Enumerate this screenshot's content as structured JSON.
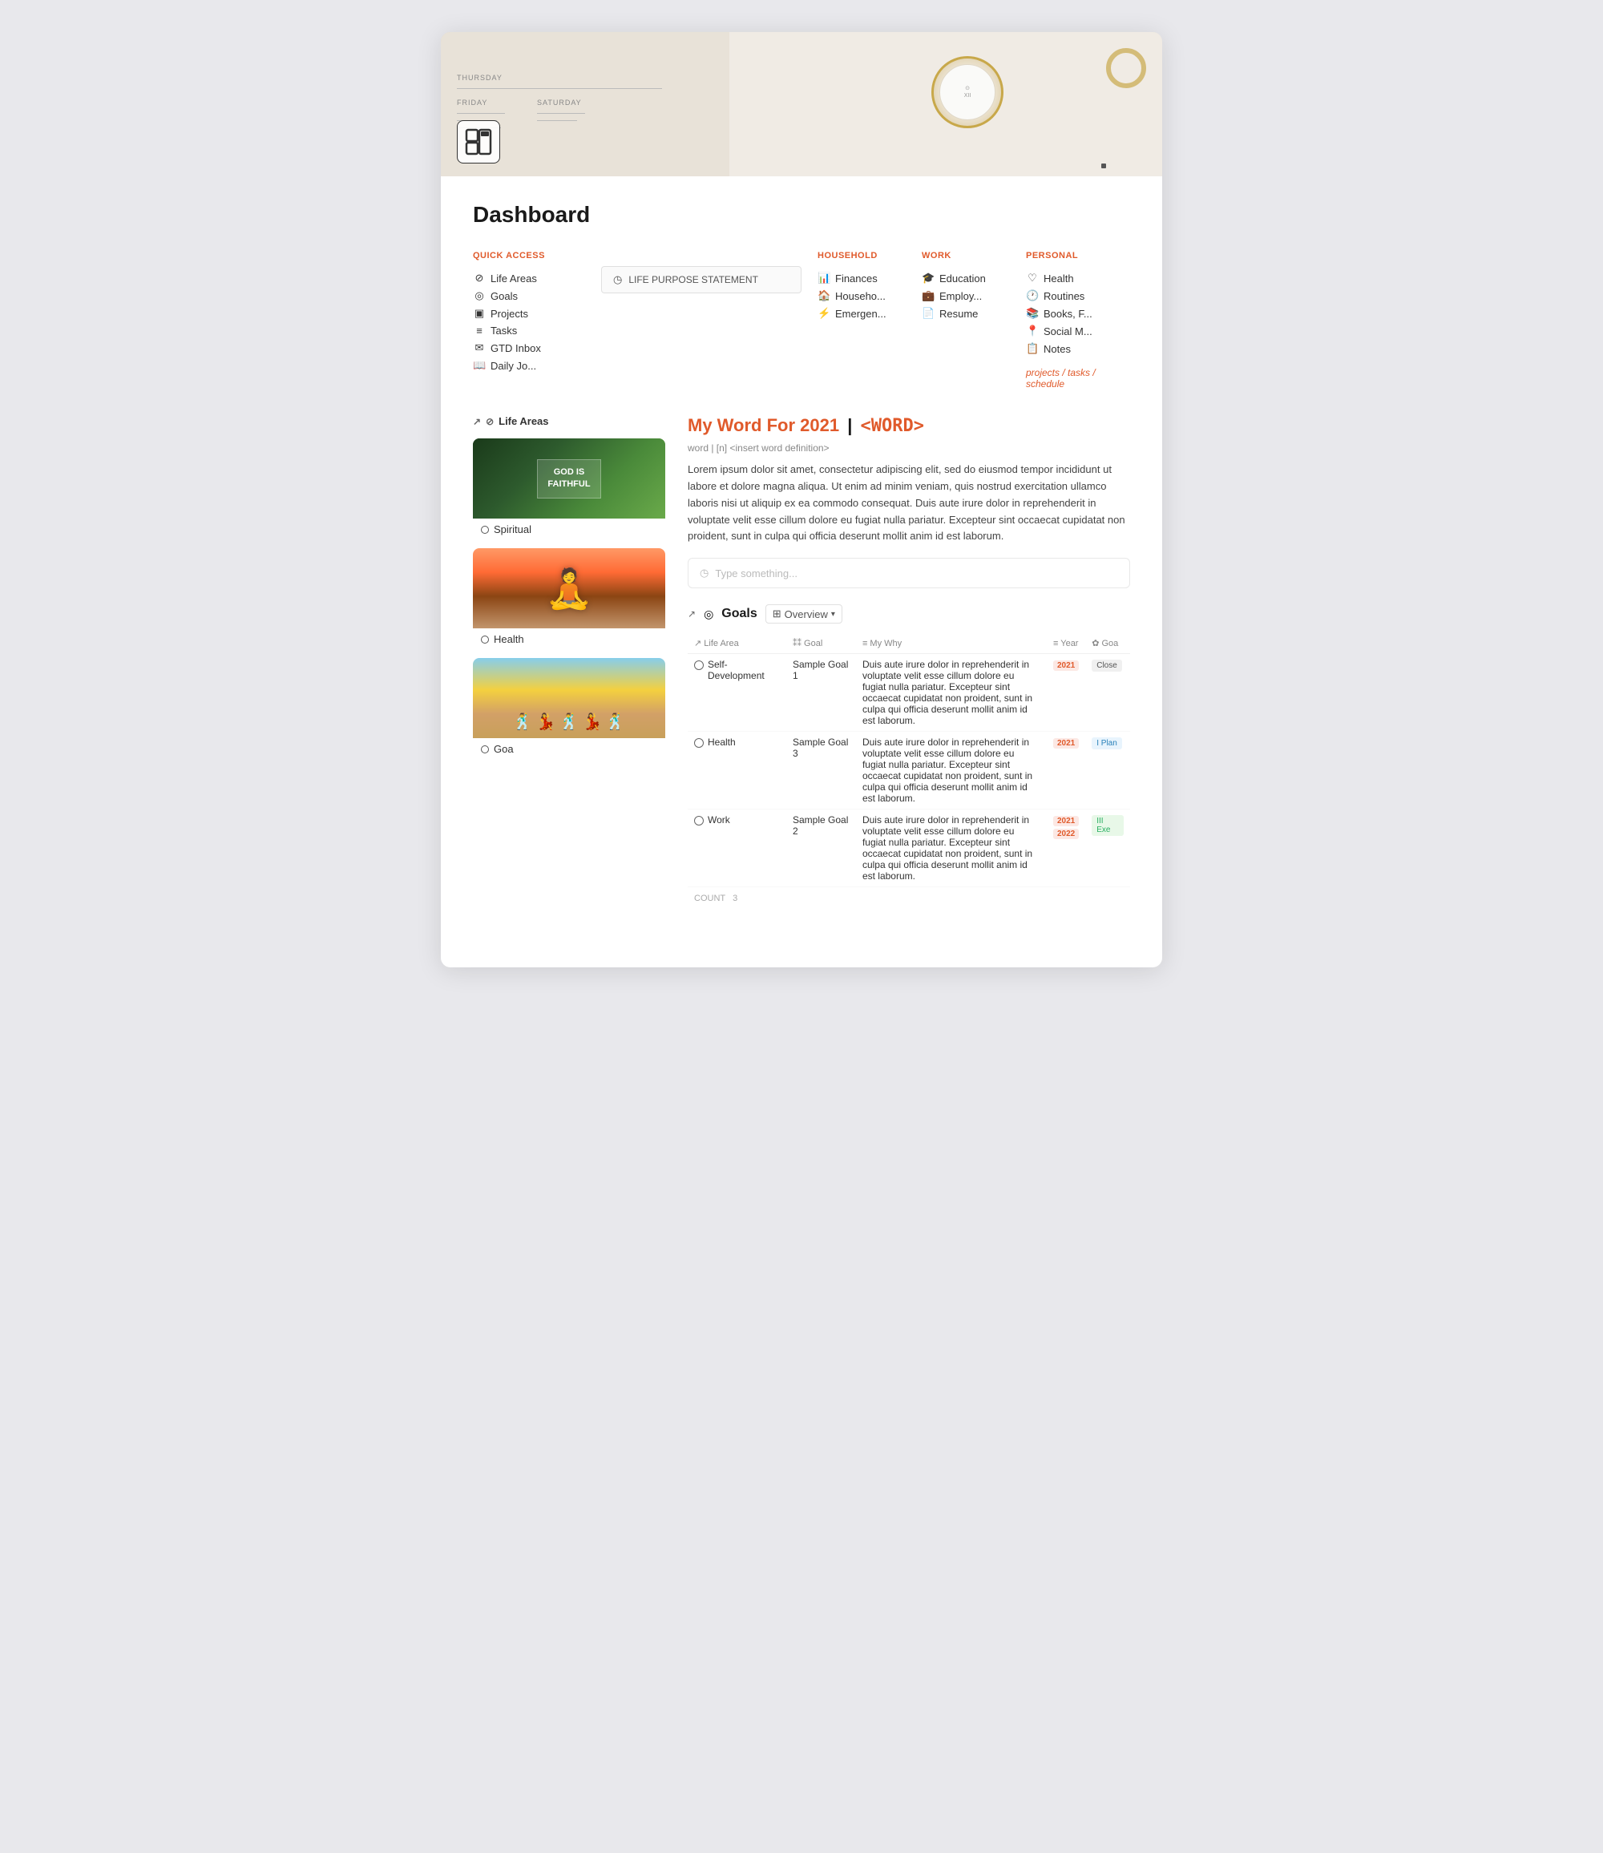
{
  "page": {
    "title": "Dashboard"
  },
  "hero": {
    "alt": "Planner and watch hero image"
  },
  "nav": {
    "quick_access": {
      "title": "QUICK ACCESS",
      "items": [
        {
          "label": "Life Areas",
          "icon": "⊘"
        },
        {
          "label": "Goals",
          "icon": "◎"
        },
        {
          "label": "Projects",
          "icon": "▣"
        },
        {
          "label": "Tasks",
          "icon": "≡"
        },
        {
          "label": "GTD Inbox",
          "icon": "✉"
        },
        {
          "label": "Daily Jo...",
          "icon": "📖"
        }
      ]
    },
    "life_purpose": {
      "label": "LIFE PURPOSE STATEMENT"
    },
    "household": {
      "title": "HOUSEHOLD",
      "items": [
        {
          "label": "Finances",
          "icon": "📊"
        },
        {
          "label": "Househo...",
          "icon": "🏠"
        },
        {
          "label": "Emergen...",
          "icon": "⚡"
        }
      ]
    },
    "work": {
      "title": "WORK",
      "items": [
        {
          "label": "Education",
          "icon": "🎓"
        },
        {
          "label": "Employ...",
          "icon": "💼"
        },
        {
          "label": "Resume",
          "icon": "📄"
        }
      ]
    },
    "personal": {
      "title": "PERSONAL",
      "items": [
        {
          "label": "Health",
          "icon": "♡"
        },
        {
          "label": "Routines",
          "icon": "🕐"
        },
        {
          "label": "Books, F...",
          "icon": "📚"
        },
        {
          "label": "Social M...",
          "icon": "📍"
        },
        {
          "label": "Notes",
          "icon": "📋"
        }
      ],
      "link": "projects / tasks / schedule"
    }
  },
  "life_areas": {
    "section_label": "Life Areas",
    "cards": [
      {
        "name": "Spiritual",
        "type": "spiritual",
        "sign_text": "GOD IS\nFAITHFUL"
      },
      {
        "name": "Health",
        "type": "health"
      },
      {
        "name": "Goa",
        "type": "friends"
      }
    ]
  },
  "word_section": {
    "my_word_label": "My Word For 2021",
    "word_placeholder": "<WORD>",
    "definition_line": "word | [n] <insert word definition>",
    "description": "Lorem ipsum dolor sit amet, consectetur adipiscing elit, sed do eiusmod tempor incididunt ut labore et dolore magna aliqua. Ut enim ad minim veniam, quis nostrud exercitation ullamco laboris nisi ut aliquip ex ea commodo consequat. Duis aute irure dolor in reprehenderit in voluptate velit esse cillum dolore eu fugiat nulla pariatur. Excepteur sint occaecat cupidatat non proident, sunt in culpa qui officia deserunt mollit anim id est laborum.",
    "type_placeholder": "Type something..."
  },
  "goals": {
    "section_label": "Goals",
    "view_label": "Overview",
    "columns": [
      {
        "label": "↗ Life Area"
      },
      {
        "label": "⁑⁑ Goal"
      },
      {
        "label": "≡ My Why"
      },
      {
        "label": "≡ Year"
      },
      {
        "label": "✿ Goa"
      }
    ],
    "rows": [
      {
        "life_area": "Self-Development",
        "goal": "Sample Goal 1",
        "why": "Duis aute irure dolor in reprehenderit in voluptate velit esse cillum dolore eu fugiat nulla pariatur. Excepteur sint occaecat cupidatat non proident, sunt in culpa qui officia deserunt mollit anim id est laborum.",
        "years": [
          "2021"
        ],
        "status": [
          "Close"
        ]
      },
      {
        "life_area": "Health",
        "goal": "Sample Goal 3",
        "why": "Duis aute irure dolor in reprehenderit in voluptate velit esse cillum dolore eu fugiat nulla pariatur. Excepteur sint occaecat cupidatat non proident, sunt in culpa qui officia deserunt mollit anim id est laborum.",
        "years": [
          "2021"
        ],
        "status": [
          "I Plan"
        ]
      },
      {
        "life_area": "Work",
        "goal": "Sample Goal 2",
        "why": "Duis aute irure dolor in reprehenderit in voluptate velit esse cillum dolore eu fugiat nulla pariatur. Excepteur sint occaecat cupidatat non proident, sunt in culpa qui officia deserunt mollit anim id est laborum.",
        "years": [
          "2021",
          "2022"
        ],
        "status": [
          "III Exe"
        ]
      }
    ],
    "count_label": "COUNT",
    "count_value": "3"
  }
}
